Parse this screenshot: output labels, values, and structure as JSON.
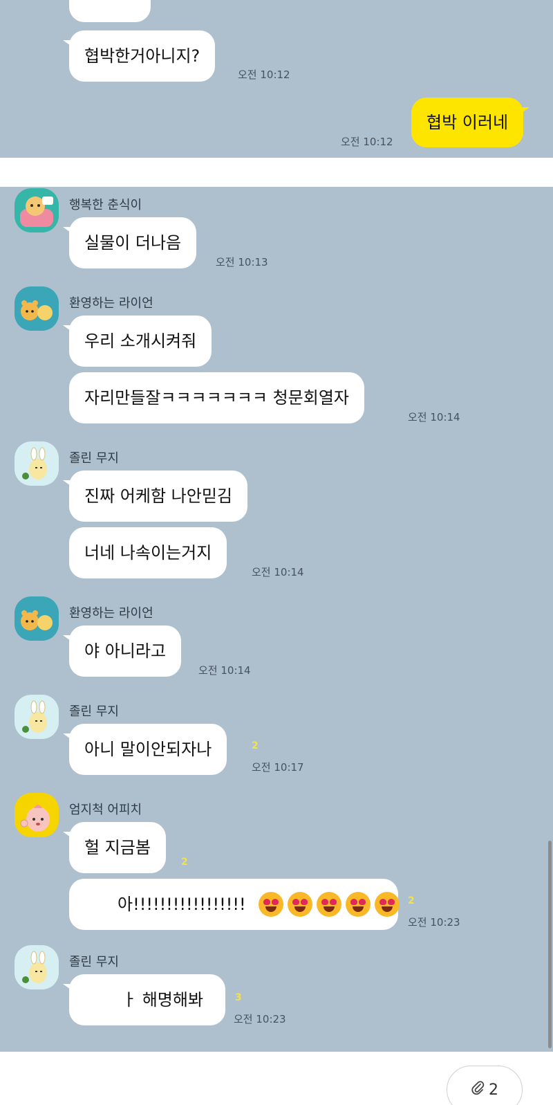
{
  "chat1": {
    "messages": [
      {
        "text": "",
        "type": "received"
      },
      {
        "text": "협박한거아니지?",
        "time": "오전 10:12",
        "type": "received"
      },
      {
        "text": "협박 이러네",
        "time": "오전 10:12",
        "type": "sent"
      }
    ]
  },
  "chat2": {
    "groups": [
      {
        "sender": "행복한 춘식이",
        "avatar_icon": "choonsik-avatar-icon",
        "messages": [
          {
            "text": "실물이 더나음"
          }
        ],
        "time": "오전 10:13"
      },
      {
        "sender": "환영하는 라이언",
        "avatar_icon": "ryan-avatar-icon",
        "messages": [
          {
            "text": "우리 소개시켜줘"
          },
          {
            "text": "자리만들잘ㅋㅋㅋㅋㅋㅋㅋ 청문회열자"
          }
        ],
        "time": "오전 10:14"
      },
      {
        "sender": "졸린 무지",
        "avatar_icon": "muzi-avatar-icon",
        "messages": [
          {
            "text": "진짜 어케함 나안믿김"
          },
          {
            "text": "너네 나속이는거지"
          }
        ],
        "time": "오전 10:14"
      },
      {
        "sender": "환영하는 라이언",
        "avatar_icon": "ryan-avatar-icon",
        "messages": [
          {
            "text": "야 아니라고"
          }
        ],
        "time": "오전 10:14"
      },
      {
        "sender": "졸린 무지",
        "avatar_icon": "muzi-avatar-icon",
        "messages": [
          {
            "text": "아니 말이안되자나",
            "unread": "2"
          }
        ],
        "time": "오전 10:17"
      },
      {
        "sender": "엄지척 어피치",
        "avatar_icon": "apeach-avatar-icon",
        "messages": [
          {
            "text": "헐 지금봄",
            "unread": "2"
          },
          {
            "text": "아!!!!!!!!!!!!!!!!!",
            "unread": "2",
            "emoji_count": 5
          }
        ],
        "time": "오전 10:23"
      },
      {
        "sender": "졸린 무지",
        "avatar_icon": "muzi-avatar-icon",
        "messages": [
          {
            "text": "ㅏ 해명해봐",
            "unread": "3"
          }
        ],
        "time": "오전 10:23"
      }
    ]
  },
  "colors": {
    "chat_background": "#aebfce",
    "sent_bubble": "#fee500",
    "received_bubble": "#ffffff",
    "unread_count": "#f3e24c"
  },
  "bottom_button": {
    "label": "2",
    "icon": "attachment-icon"
  }
}
